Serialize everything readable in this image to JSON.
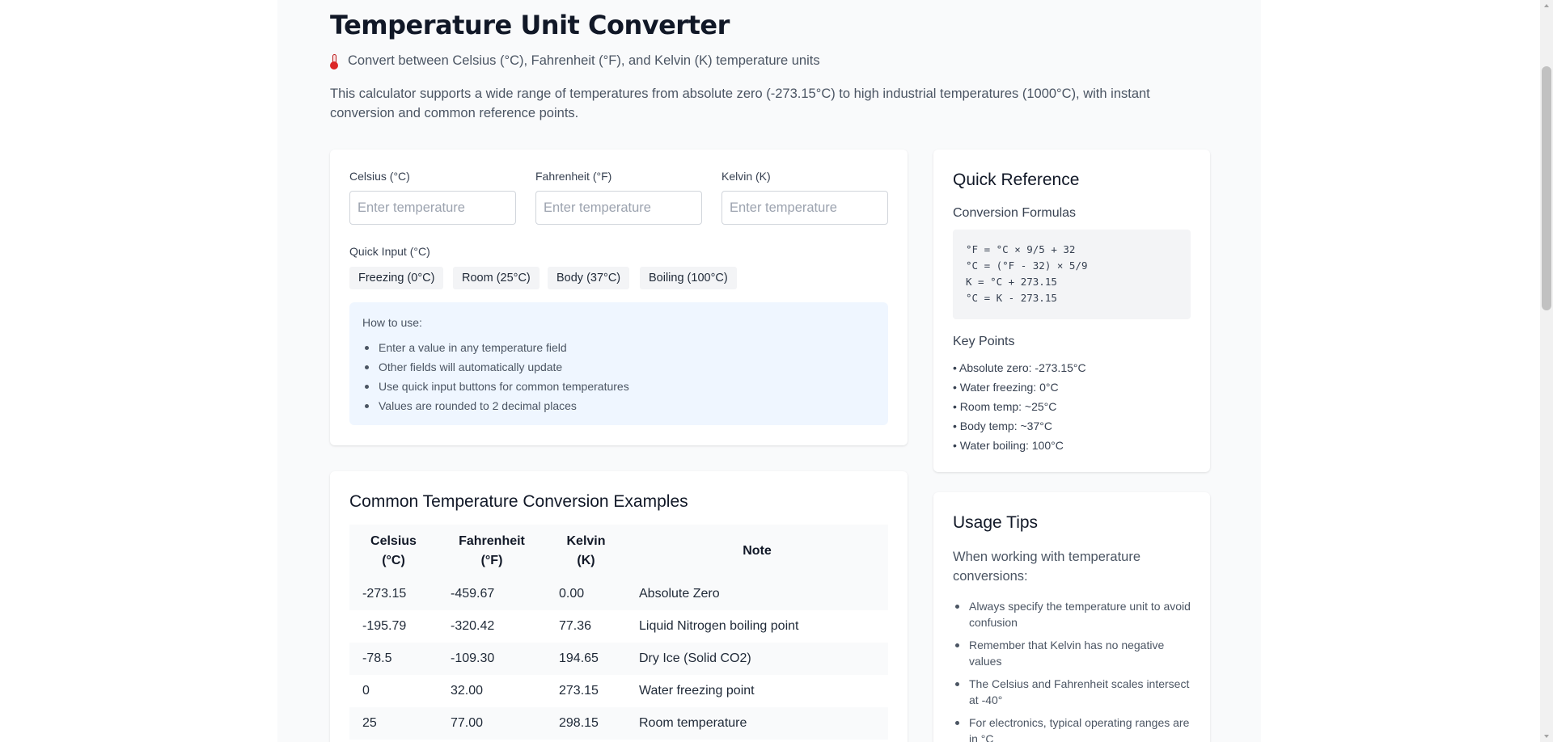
{
  "header": {
    "title": "Temperature Unit Converter",
    "subtitle": "Convert between Celsius (°C), Fahrenheit (°F), and Kelvin (K) temperature units",
    "subtitle_icon": "thermometer-icon",
    "description": "This calculator supports a wide range of temperatures from absolute zero (-273.15°C) to high industrial temperatures (1000°C), with instant conversion and common reference points."
  },
  "converter": {
    "fields": [
      {
        "label": "Celsius (°C)",
        "placeholder": "Enter temperature",
        "value": ""
      },
      {
        "label": "Fahrenheit (°F)",
        "placeholder": "Enter temperature",
        "value": ""
      },
      {
        "label": "Kelvin (K)",
        "placeholder": "Enter temperature",
        "value": ""
      }
    ],
    "quick_input_label": "Quick Input (°C)",
    "quick_buttons": [
      "Freezing (0°C)",
      "Room (25°C)",
      "Body (37°C)",
      "Boiling (100°C)"
    ],
    "howto": {
      "title": "How to use:",
      "items": [
        "Enter a value in any temperature field",
        "Other fields will automatically update",
        "Use quick input buttons for common temperatures",
        "Values are rounded to 2 decimal places"
      ]
    }
  },
  "examples": {
    "title": "Common Temperature Conversion Examples",
    "headers": [
      "Celsius (°C)",
      "Fahrenheit (°F)",
      "Kelvin (K)",
      "Note"
    ],
    "rows": [
      [
        "-273.15",
        "-459.67",
        "0.00",
        "Absolute Zero"
      ],
      [
        "-195.79",
        "-320.42",
        "77.36",
        "Liquid Nitrogen boiling point"
      ],
      [
        "-78.5",
        "-109.30",
        "194.65",
        "Dry Ice (Solid CO2)"
      ],
      [
        "0",
        "32.00",
        "273.15",
        "Water freezing point"
      ],
      [
        "25",
        "77.00",
        "298.15",
        "Room temperature"
      ]
    ]
  },
  "reference": {
    "title": "Quick Reference",
    "formulas_title": "Conversion Formulas",
    "formulas": [
      "°F = °C × 9/5 + 32",
      "°C = (°F - 32) × 5/9",
      "K = °C + 273.15",
      "°C = K - 273.15"
    ],
    "key_points_title": "Key Points",
    "key_points": [
      "• Absolute zero: -273.15°C",
      "• Water freezing: 0°C",
      "• Room temp: ~25°C",
      "• Body temp: ~37°C",
      "• Water boiling: 100°C"
    ]
  },
  "tips": {
    "title": "Usage Tips",
    "intro": "When working with temperature conversions:",
    "items": [
      "Always specify the temperature unit to avoid confusion",
      "Remember that Kelvin has no negative values",
      "The Celsius and Fahrenheit scales intersect at -40°",
      "For electronics, typical operating ranges are in °C"
    ]
  }
}
